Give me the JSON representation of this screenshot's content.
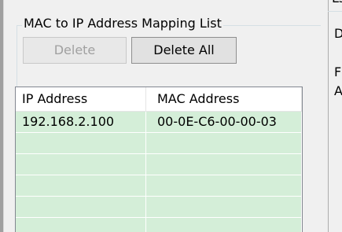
{
  "group": {
    "title": "MAC to IP Address Mapping List"
  },
  "buttons": {
    "delete": "Delete",
    "delete_all": "Delete All"
  },
  "list": {
    "columns": [
      "IP Address",
      "MAC Address"
    ],
    "rows": [
      {
        "ip": "192.168.2.100",
        "mac": "00-0E-C6-00-00-03"
      },
      {
        "ip": "",
        "mac": ""
      },
      {
        "ip": "",
        "mac": ""
      },
      {
        "ip": "",
        "mac": ""
      },
      {
        "ip": "",
        "mac": ""
      },
      {
        "ip": "",
        "mac": ""
      }
    ]
  },
  "right_panel": {
    "top_fragment": "Ls",
    "line1": "D",
    "line2": "F",
    "line3": "A"
  },
  "colors": {
    "background": "#f0f0f0",
    "row_fill": "#d4eed8",
    "button_face": "#e1e1e1",
    "disabled_text": "#a0a0a0"
  }
}
